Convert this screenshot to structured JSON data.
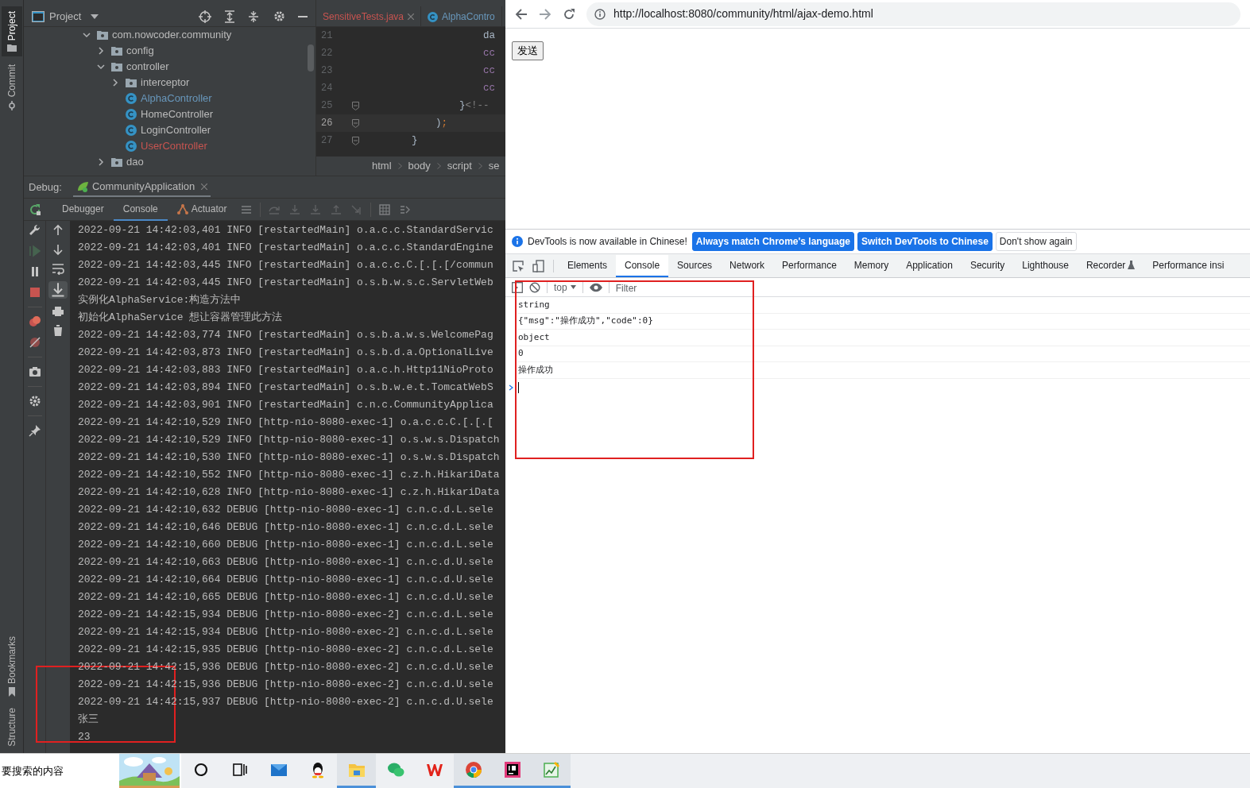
{
  "ide": {
    "tool_windows_top": [
      {
        "label": "Project",
        "selected": true
      },
      {
        "label": "Commit",
        "selected": false
      }
    ],
    "tool_windows_bottom": [
      {
        "label": "Bookmarks"
      },
      {
        "label": "Structure"
      }
    ],
    "project_panel": {
      "title": "Project",
      "tree": [
        {
          "label": "com.nowcoder.community",
          "kind": "package",
          "expanded": true,
          "children": [
            {
              "label": "config",
              "kind": "package",
              "expanded": false
            },
            {
              "label": "controller",
              "kind": "package",
              "expanded": true,
              "children": [
                {
                  "label": "interceptor",
                  "kind": "package",
                  "expanded": false
                },
                {
                  "label": "AlphaController",
                  "kind": "class",
                  "color": "#6897bb"
                },
                {
                  "label": "HomeController",
                  "kind": "class",
                  "color": "#bbbbbb"
                },
                {
                  "label": "LoginController",
                  "kind": "class",
                  "color": "#bbbbbb"
                },
                {
                  "label": "UserController",
                  "kind": "class",
                  "color": "#c75450"
                }
              ]
            },
            {
              "label": "dao",
              "kind": "package",
              "expanded": false
            }
          ]
        }
      ]
    },
    "editor": {
      "tabs": [
        {
          "label": "SensitiveTests.java",
          "color": "#c75450",
          "closable": true
        },
        {
          "label": "AlphaContro",
          "color": "#6897bb",
          "closable": false
        }
      ],
      "lines": [
        {
          "number": "21",
          "current": false,
          "tokens": [
            {
              "text": "                    da",
              "color": "#a9b7c6"
            }
          ]
        },
        {
          "number": "22",
          "current": false,
          "tokens": [
            {
              "text": "                    cc",
              "color": "#9876aa"
            }
          ]
        },
        {
          "number": "23",
          "current": false,
          "tokens": [
            {
              "text": "                    cc",
              "color": "#9876aa"
            }
          ]
        },
        {
          "number": "24",
          "current": false,
          "tokens": [
            {
              "text": "                    cc",
              "color": "#9876aa"
            }
          ]
        },
        {
          "number": "25",
          "current": false,
          "tokens": [
            {
              "text": "                }",
              "color": "#a9b7c6"
            },
            {
              "text": "<!--",
              "color": "#808080"
            }
          ]
        },
        {
          "number": "26",
          "current": true,
          "tokens": [
            {
              "text": "            )",
              "color": "#a9b7c6"
            },
            {
              "text": ";",
              "color": "#cc7832"
            }
          ]
        },
        {
          "number": "27",
          "current": false,
          "tokens": [
            {
              "text": "        }",
              "color": "#a9b7c6"
            }
          ]
        }
      ],
      "breadcrumbs": [
        "html",
        "body",
        "script",
        "se"
      ]
    },
    "debug": {
      "label": "Debug:",
      "session": "CommunityApplication",
      "tabs": [
        {
          "label": "Debugger",
          "selected": false
        },
        {
          "label": "Console",
          "selected": true
        },
        {
          "label": "Actuator",
          "selected": false
        }
      ],
      "console_lines": [
        "2022-09-21 14:42:03,401 INFO [restartedMain] o.a.c.c.StandardServic",
        "2022-09-21 14:42:03,401 INFO [restartedMain] o.a.c.c.StandardEngine",
        "2022-09-21 14:42:03,445 INFO [restartedMain] o.a.c.c.C.[.[.[/commun",
        "2022-09-21 14:42:03,445 INFO [restartedMain] o.s.b.w.s.c.ServletWeb",
        "实例化AlphaService:构造方法中",
        "初始化AlphaService 想让容器管理此方法",
        "2022-09-21 14:42:03,774 INFO [restartedMain] o.s.b.a.w.s.WelcomePag",
        "2022-09-21 14:42:03,873 INFO [restartedMain] o.s.b.d.a.OptionalLive",
        "2022-09-21 14:42:03,883 INFO [restartedMain] o.a.c.h.Http11NioProto",
        "2022-09-21 14:42:03,894 INFO [restartedMain] o.s.b.w.e.t.TomcatWebS",
        "2022-09-21 14:42:03,901 INFO [restartedMain] c.n.c.CommunityApplica",
        "2022-09-21 14:42:10,529 INFO [http-nio-8080-exec-1] o.a.c.c.C.[.[.[",
        "2022-09-21 14:42:10,529 INFO [http-nio-8080-exec-1] o.s.w.s.Dispatch",
        "2022-09-21 14:42:10,530 INFO [http-nio-8080-exec-1] o.s.w.s.Dispatch",
        "2022-09-21 14:42:10,552 INFO [http-nio-8080-exec-1] c.z.h.HikariData",
        "2022-09-21 14:42:10,628 INFO [http-nio-8080-exec-1] c.z.h.HikariData",
        "2022-09-21 14:42:10,632 DEBUG [http-nio-8080-exec-1] c.n.c.d.L.sele",
        "2022-09-21 14:42:10,646 DEBUG [http-nio-8080-exec-1] c.n.c.d.L.sele",
        "2022-09-21 14:42:10,660 DEBUG [http-nio-8080-exec-1] c.n.c.d.L.sele",
        "2022-09-21 14:42:10,663 DEBUG [http-nio-8080-exec-1] c.n.c.d.U.sele",
        "2022-09-21 14:42:10,664 DEBUG [http-nio-8080-exec-1] c.n.c.d.U.sele",
        "2022-09-21 14:42:10,665 DEBUG [http-nio-8080-exec-1] c.n.c.d.U.sele",
        "2022-09-21 14:42:15,934 DEBUG [http-nio-8080-exec-2] c.n.c.d.L.sele",
        "2022-09-21 14:42:15,934 DEBUG [http-nio-8080-exec-2] c.n.c.d.L.sele",
        "2022-09-21 14:42:15,935 DEBUG [http-nio-8080-exec-2] c.n.c.d.L.sele",
        "2022-09-21 14:42:15,936 DEBUG [http-nio-8080-exec-2] c.n.c.d.U.sele",
        "2022-09-21 14:42:15,936 DEBUG [http-nio-8080-exec-2] c.n.c.d.U.sele",
        "2022-09-21 14:42:15,937 DEBUG [http-nio-8080-exec-2] c.n.c.d.U.sele",
        "张三",
        "23"
      ]
    }
  },
  "browser": {
    "url": "http://localhost:8080/community/html/ajax-demo.html",
    "page": {
      "button": "发送"
    },
    "devtools": {
      "infobar": {
        "message": "DevTools is now available in Chinese!",
        "buttons": [
          {
            "label": "Always match Chrome's language",
            "kind": "primary"
          },
          {
            "label": "Switch DevTools to Chinese",
            "kind": "primary"
          },
          {
            "label": "Don't show again",
            "kind": "plain"
          }
        ]
      },
      "tabs": [
        {
          "label": "Elements",
          "selected": false
        },
        {
          "label": "Console",
          "selected": true
        },
        {
          "label": "Sources",
          "selected": false
        },
        {
          "label": "Network",
          "selected": false
        },
        {
          "label": "Performance",
          "selected": false
        },
        {
          "label": "Memory",
          "selected": false
        },
        {
          "label": "Application",
          "selected": false
        },
        {
          "label": "Security",
          "selected": false
        },
        {
          "label": "Lighthouse",
          "selected": false
        },
        {
          "label": "Recorder",
          "selected": false
        },
        {
          "label": "Performance insi",
          "selected": false
        }
      ],
      "context": "top",
      "filter_placeholder": "Filter",
      "messages": [
        "string",
        "{\"msg\":\"操作成功\",\"code\":0}",
        "object",
        "0",
        "操作成功"
      ]
    }
  },
  "taskbar": {
    "search_text": "要搜索的内容",
    "apps": [
      {
        "kind": "cortana",
        "active": false
      },
      {
        "kind": "taskview",
        "active": false
      },
      {
        "kind": "mail",
        "active": false
      },
      {
        "kind": "qq",
        "active": false
      },
      {
        "kind": "explorer",
        "active": true
      },
      {
        "kind": "wechat",
        "active": false
      },
      {
        "kind": "wps",
        "active": false
      },
      {
        "kind": "chrome",
        "active": true
      },
      {
        "kind": "idea",
        "active": true
      },
      {
        "kind": "notes",
        "active": true
      }
    ]
  }
}
